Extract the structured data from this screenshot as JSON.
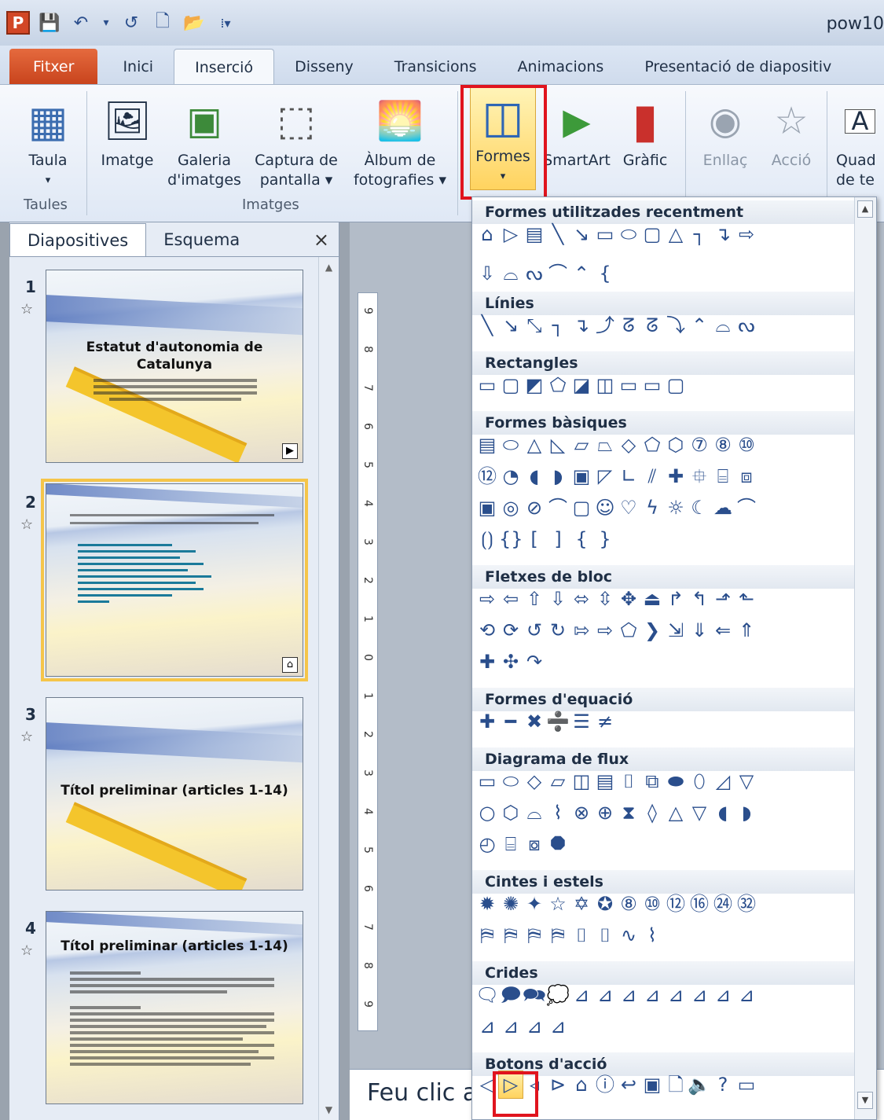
{
  "app": {
    "title": "pow10",
    "logo": "P"
  },
  "qat": {
    "save": "💾",
    "undo": "↶",
    "undo_arrow": "▾",
    "redo": "↺",
    "new": "🗋",
    "open": "📂",
    "customize": "⁞▾"
  },
  "tabs": [
    "Fitxer",
    "Inici",
    "Inserció",
    "Disseny",
    "Transicions",
    "Animacions",
    "Presentació de diapositiv"
  ],
  "ribbon": {
    "taula": {
      "icon": "▦",
      "line1": "Taula",
      "line2": "▾"
    },
    "imatge": {
      "icon": "🖼",
      "line1": "Imatge"
    },
    "galeria": {
      "icon": "▣",
      "line1": "Galeria",
      "line2": "d'imatges"
    },
    "captura": {
      "icon": "⬚",
      "line1": "Captura de",
      "line2": "pantalla ▾"
    },
    "album": {
      "icon": "🌅",
      "line1": "Àlbum de",
      "line2": "fotografies ▾"
    },
    "formes": {
      "icon": "◫",
      "line1": "Formes",
      "line2": "▾"
    },
    "smartart": {
      "icon": "▶",
      "line1": "SmartArt"
    },
    "grafic": {
      "icon": "▮",
      "line1": "Gràfic"
    },
    "enllac": {
      "icon": "◉",
      "line1": "Enllaç"
    },
    "accio": {
      "icon": "☆",
      "line1": "Acció"
    },
    "quad": {
      "icon": "A",
      "line1": "Quad",
      "line2": "de te"
    },
    "groups": {
      "taules": "Taules",
      "imatges": "Imatges"
    }
  },
  "pane": {
    "tab_slides": "Diapositives",
    "tab_outline": "Esquema",
    "close": "×",
    "scroll_up": "▲",
    "scroll_down": "▼"
  },
  "slides": [
    {
      "num": "1",
      "star": "☆",
      "title1": "Estatut d'autonomia de",
      "title2": "Catalunya",
      "icon": "▶"
    },
    {
      "num": "2",
      "star": "☆",
      "icon": "⌂"
    },
    {
      "num": "3",
      "star": "☆",
      "title1": "Títol preliminar (articles 1-14)"
    },
    {
      "num": "4",
      "star": "☆",
      "title1": "Títol preliminar (articles 1-14)"
    }
  ],
  "ruler": [
    "9",
    "8",
    "7",
    "6",
    "5",
    "4",
    "3",
    "2",
    "1",
    "0",
    "1",
    "2",
    "3",
    "4",
    "5",
    "6",
    "7",
    "8",
    "9"
  ],
  "notes": {
    "text": "Feu clic a"
  },
  "shapes_panel": {
    "scroll_up": "▲",
    "scroll_down": "▼",
    "categories": [
      {
        "name": "Formes utilitzades recentment",
        "rows": [
          [
            "⌂",
            "▷",
            "▤",
            "╲",
            "↘",
            "▭",
            "⬭",
            "▢",
            "△",
            "┐",
            "↴",
            "⇨"
          ],
          [
            "⇩",
            "⌓",
            "ᔓ",
            "⌒",
            "⌃",
            "{"
          ]
        ]
      },
      {
        "name": "Línies",
        "rows": [
          [
            "╲",
            "↘",
            "⤡",
            "┐",
            "↴",
            "⤴",
            "ᘔ",
            "ᘔ",
            "⤵",
            "⌃",
            "⌓",
            "ᔓ"
          ]
        ]
      },
      {
        "name": "Rectangles",
        "rows": [
          [
            "▭",
            "▢",
            "◩",
            "⬠",
            "◪",
            "◫",
            "▭",
            "▭",
            "▢"
          ]
        ]
      },
      {
        "name": "Formes bàsiques",
        "rows": [
          [
            "▤",
            "⬭",
            "△",
            "◺",
            "▱",
            "⏢",
            "◇",
            "⬠",
            "⬡",
            "⑦",
            "⑧",
            "⑩"
          ],
          [
            "⑫",
            "◔",
            "◖",
            "◗",
            "▣",
            "◸",
            "∟",
            "⫽",
            "✚",
            "⯐",
            "⌸",
            "⧈"
          ],
          [
            "▣",
            "◎",
            "⊘",
            "⌒",
            "▢",
            "☺",
            "♡",
            "ϟ",
            "☼",
            "☾",
            "☁",
            "⌒"
          ],
          [
            "⟮⟯",
            "{}",
            "[",
            "]",
            "{",
            "}"
          ]
        ]
      },
      {
        "name": "Fletxes de bloc",
        "rows": [
          [
            "⇨",
            "⇦",
            "⇧",
            "⇩",
            "⬄",
            "⇳",
            "✥",
            "⏏",
            "↱",
            "↰",
            "⬏",
            "⬑"
          ],
          [
            "⟲",
            "⟳",
            "↺",
            "↻",
            "⇰",
            "⇨",
            "⬠",
            "❯",
            "⇲",
            "⇓",
            "⇐",
            "⇑"
          ],
          [
            "✚",
            "✣",
            "↷"
          ]
        ]
      },
      {
        "name": "Formes d'equació",
        "rows": [
          [
            "✚",
            "━",
            "✖",
            "➗",
            "☰",
            "≠"
          ]
        ]
      },
      {
        "name": "Diagrama de flux",
        "rows": [
          [
            "▭",
            "⬭",
            "◇",
            "▱",
            "◫",
            "▤",
            "⌷",
            "⧉",
            "⬬",
            "⬯",
            "◿",
            "▽"
          ],
          [
            "○",
            "⬡",
            "⌓",
            "⌇",
            "⊗",
            "⊕",
            "⧗",
            "◊",
            "△",
            "▽",
            "◖",
            "◗"
          ],
          [
            "◴",
            "⌸",
            "⧇",
            "⯃"
          ]
        ]
      },
      {
        "name": "Cintes i estels",
        "rows": [
          [
            "✹",
            "✺",
            "✦",
            "☆",
            "✡",
            "✪",
            "⑧",
            "⑩",
            "⑫",
            "⑯",
            "㉔",
            "㉜"
          ],
          [
            "⛿",
            "⛿",
            "⛿",
            "⛿",
            "⌷",
            "⌷",
            "∿",
            "⌇"
          ]
        ]
      },
      {
        "name": "Crides",
        "rows": [
          [
            "🗨",
            "🗩",
            "🗪",
            "💭",
            "⊿",
            "⊿",
            "⊿",
            "⊿",
            "⊿",
            "⊿",
            "⊿",
            "⊿"
          ],
          [
            "⊿",
            "⊿",
            "⊿",
            "⊿"
          ]
        ]
      },
      {
        "name": "Botons d'acció",
        "rows": [
          [
            "◁",
            "▷",
            "◃",
            "⊳",
            "⌂",
            "ⓘ",
            "↩",
            "▣",
            "🗋",
            "🔈",
            "?",
            "▭"
          ]
        ]
      }
    ]
  },
  "colors": {
    "file_tab": "#d24726",
    "highlight": "#ffd35f",
    "red_box": "#e0141e"
  }
}
